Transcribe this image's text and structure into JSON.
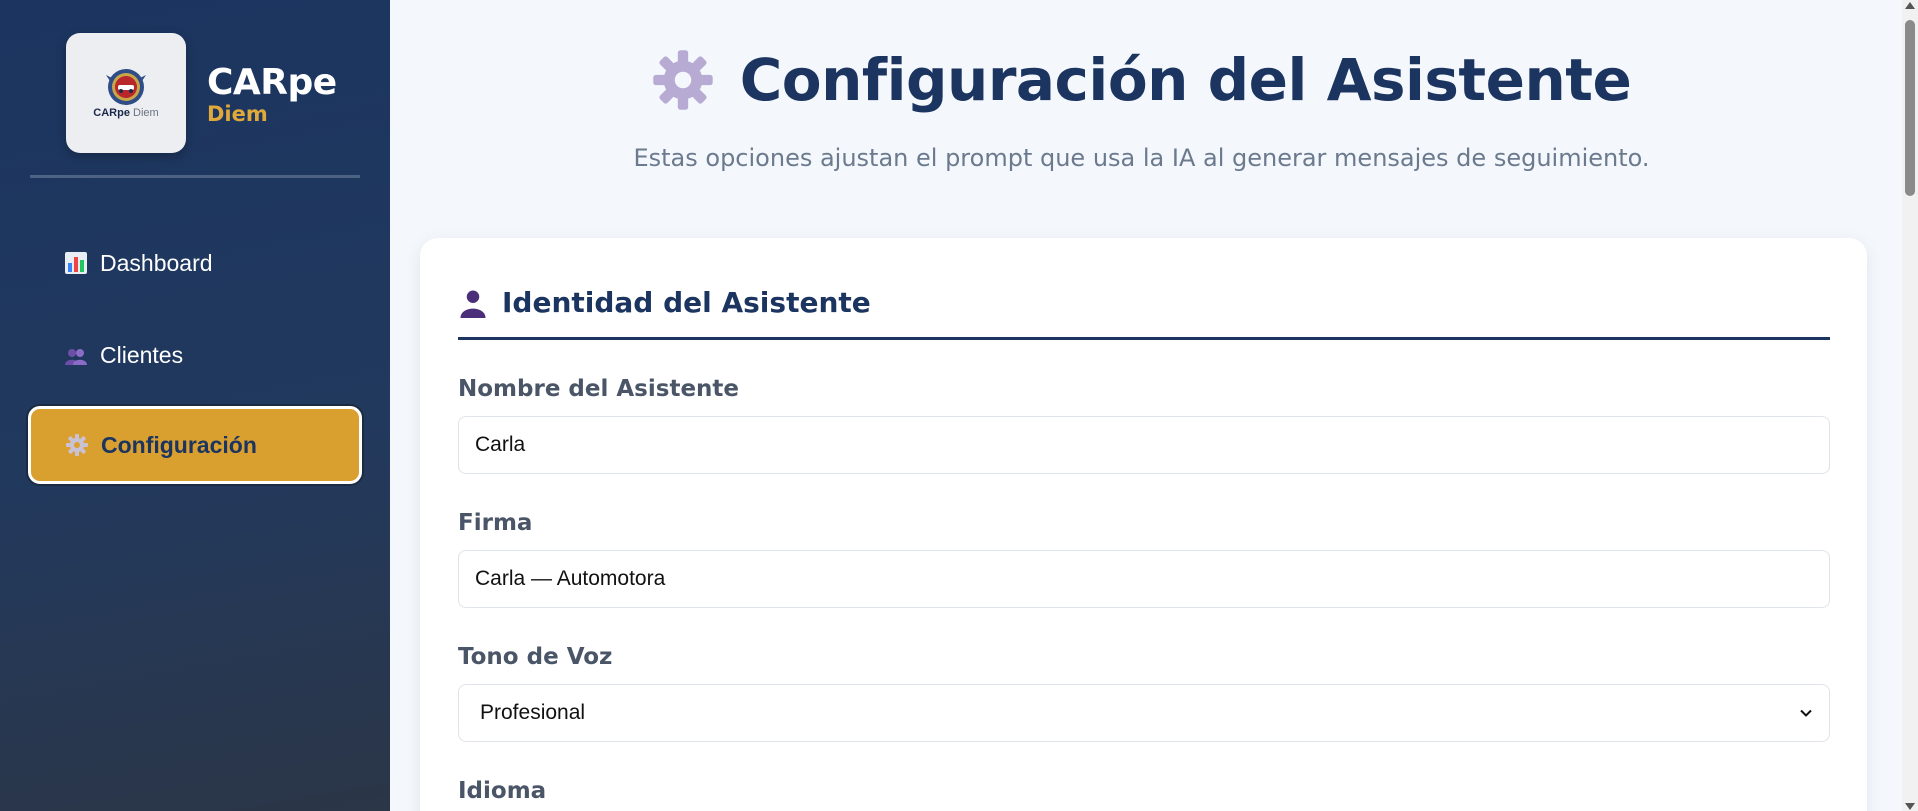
{
  "sidebar": {
    "logo": {
      "emblem_icon": "car-badge-logo-icon",
      "mini_text_a": "CARpe",
      "mini_text_b": "Diem"
    },
    "brand": {
      "title": "CARpe",
      "subtitle": "Diem"
    },
    "nav": [
      {
        "label": "Dashboard",
        "icon": "bar-chart-icon",
        "active": false
      },
      {
        "label": "Clientes",
        "icon": "users-icon",
        "active": false
      },
      {
        "label": "Configuración",
        "icon": "gear-icon",
        "active": true
      }
    ]
  },
  "header": {
    "icon": "gear-icon",
    "title": "Configuración del Asistente",
    "subtitle": "Estas opciones ajustan el prompt que usa la IA al generar mensajes de seguimiento."
  },
  "section": {
    "icon": "person-icon",
    "title": "Identidad del Asistente",
    "fields": [
      {
        "label": "Nombre del Asistente",
        "value": "Carla",
        "type": "text"
      },
      {
        "label": "Firma",
        "value": "Carla — Automotora",
        "type": "text"
      },
      {
        "label": "Tono de Voz",
        "value": "Profesional",
        "type": "select"
      },
      {
        "label": "Idioma",
        "type": "select"
      }
    ]
  },
  "colors": {
    "primary": "#1b3560",
    "accent": "#d9a030",
    "brand_sub": "#e0a93a"
  }
}
